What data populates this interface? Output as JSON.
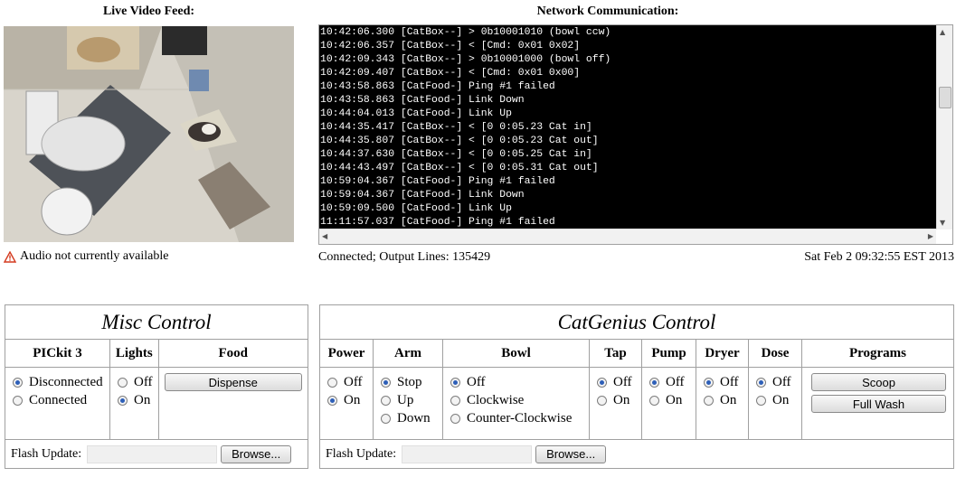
{
  "video": {
    "title": "Live Video Feed:",
    "audio_status": "Audio not currently available",
    "warning_icon": "warning-triangle"
  },
  "network": {
    "title": "Network Communication:",
    "lines": [
      "10:42:06.300 [CatBox--] > 0b10001010 (bowl ccw)",
      "10:42:06.357 [CatBox--] < [Cmd: 0x01 0x02]",
      "10:42:09.343 [CatBox--] > 0b10001000 (bowl off)",
      "10:42:09.407 [CatBox--] < [Cmd: 0x01 0x00]",
      "10:43:58.863 [CatFood-] Ping #1 failed",
      "10:43:58.863 [CatFood-] Link Down",
      "10:44:04.013 [CatFood-] Link Up",
      "10:44:35.417 [CatBox--] < [0 0:05.23 Cat in]",
      "10:44:35.807 [CatBox--] < [0 0:05.23 Cat out]",
      "10:44:37.630 [CatBox--] < [0 0:05.25 Cat in]",
      "10:44:43.497 [CatBox--] < [0 0:05.31 Cat out]",
      "10:59:04.367 [CatFood-] Ping #1 failed",
      "10:59:04.367 [CatFood-] Link Down",
      "10:59:09.500 [CatFood-] Link Up",
      "11:11:57.037 [CatFood-] Ping #1 failed"
    ],
    "status": "Connected; Output Lines: 135429",
    "datetime": "Sat Feb 2 09:32:55 EST 2013"
  },
  "misc": {
    "title": "Misc Control",
    "pickit": {
      "label": "PICkit 3",
      "options": [
        "Disconnected",
        "Connected"
      ],
      "selected": "Disconnected"
    },
    "lights": {
      "label": "Lights",
      "options": [
        "Off",
        "On"
      ],
      "selected": "On"
    },
    "food": {
      "label": "Food",
      "button": "Dispense"
    },
    "flash_label": "Flash Update:",
    "browse_label": "Browse..."
  },
  "catgenius": {
    "title": "CatGenius Control",
    "power": {
      "label": "Power",
      "options": [
        "Off",
        "On"
      ],
      "selected": "On"
    },
    "arm": {
      "label": "Arm",
      "options": [
        "Stop",
        "Up",
        "Down"
      ],
      "selected": "Stop"
    },
    "bowl": {
      "label": "Bowl",
      "options": [
        "Off",
        "Clockwise",
        "Counter-Clockwise"
      ],
      "selected": "Off"
    },
    "tap": {
      "label": "Tap",
      "options": [
        "Off",
        "On"
      ],
      "selected": "Off"
    },
    "pump": {
      "label": "Pump",
      "options": [
        "Off",
        "On"
      ],
      "selected": "Off"
    },
    "dryer": {
      "label": "Dryer",
      "options": [
        "Off",
        "On"
      ],
      "selected": "Off"
    },
    "dose": {
      "label": "Dose",
      "options": [
        "Off",
        "On"
      ],
      "selected": "Off"
    },
    "programs": {
      "label": "Programs",
      "scoop": "Scoop",
      "full_wash": "Full Wash"
    },
    "flash_label": "Flash Update:",
    "browse_label": "Browse..."
  }
}
